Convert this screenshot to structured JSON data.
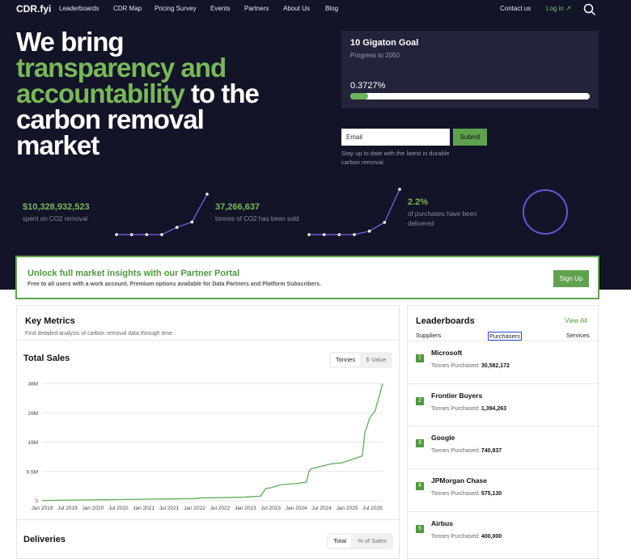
{
  "nav": {
    "logo": "CDR.fyi",
    "links": [
      "Leaderboards",
      "CDR Map",
      "Pricing Survey",
      "Events",
      "Partners",
      "About Us",
      "Blog"
    ],
    "contact": "Contact us",
    "login": "Log in ↗"
  },
  "hero": {
    "line1": "We bring",
    "line2": "transparency and",
    "line3_green": "accountability",
    "line3_rest": " to the",
    "line4": "carbon removal",
    "line5": "market"
  },
  "goal": {
    "title": "10 Gigaton Goal",
    "subtitle": "Progress to 2050",
    "percent_text": "0.3727%",
    "progress_fraction": 0.075
  },
  "newsletter": {
    "placeholder": "Email",
    "submit": "Submit",
    "note": "Stay up to date with the latest in durable carbon removal."
  },
  "stats": [
    {
      "value": "$10,328,932,523",
      "label": "spent on CO2 removal"
    },
    {
      "value": "37,266,637",
      "label": "tonnes of CO2 has been sold"
    },
    {
      "value": "2.2%",
      "label": "of purchases have been delivered"
    }
  ],
  "partner": {
    "title": "Unlock full market insights with our Partner Portal",
    "subtitle": "Free to all users with a work account.  Premium options available for Data Partners and Platform Subscribers.",
    "button": "Sign Up"
  },
  "metrics": {
    "title": "Key Metrics",
    "subtitle": "Find detailed analysis of carbon removal data through time.",
    "sales_title": "Total Sales",
    "sales_toggle": [
      "Tonnes",
      "$ Value"
    ],
    "deliveries_title": "Deliveries",
    "deliveries_toggle": [
      "Total",
      "% of Sales"
    ]
  },
  "chart_data": {
    "type": "line",
    "title": "Total Sales",
    "ylabel": "",
    "xlabel": "",
    "ylim": [
      0,
      38
    ],
    "yticks": [
      "0",
      "9.5M",
      "19M",
      "29M",
      "38M"
    ],
    "xticks": [
      "Jan 2019",
      "Jul 2019",
      "Jan 2020",
      "Jul 2020",
      "Jan 2021",
      "Jul 2021",
      "Jan 2022",
      "Jul 2022",
      "Jan 2023",
      "Jul 2023",
      "Jan 2024",
      "Jul 2024",
      "Jan 2025",
      "Jul 2025"
    ],
    "grid": true,
    "color": "#5fae5a",
    "series": [
      {
        "x": [
          2019.0,
          2019.5,
          2020.0,
          2020.5,
          2021.0,
          2021.5,
          2022.0,
          2022.1,
          2022.5,
          2023.0,
          2023.3,
          2023.4,
          2023.5,
          2023.7,
          2024.0,
          2024.2,
          2024.25,
          2024.3,
          2024.5,
          2024.7,
          2024.9,
          2025.1,
          2025.3,
          2025.35,
          2025.45,
          2025.55,
          2025.65,
          2025.7
        ],
        "values": [
          0.1,
          0.2,
          0.3,
          0.4,
          0.5,
          0.6,
          0.7,
          0.9,
          1.0,
          1.2,
          1.5,
          4.0,
          4.2,
          5.2,
          5.6,
          6.0,
          9.5,
          10.4,
          11.2,
          12.0,
          12.3,
          13.4,
          14.5,
          22.0,
          27.0,
          29.0,
          35.0,
          38.0
        ]
      }
    ]
  },
  "leaderboards": {
    "title": "Leaderboards",
    "view_all": "View All",
    "tabs": [
      "Suppliers",
      "Purchasers",
      "Services"
    ],
    "detail_label": "Tonnes Purchased:",
    "rows": [
      {
        "rank": "1",
        "name": "Microsoft",
        "value": "30,582,172"
      },
      {
        "rank": "2",
        "name": "Frontier Buyers",
        "value": "1,394,263"
      },
      {
        "rank": "3",
        "name": "Google",
        "value": "740,837"
      },
      {
        "rank": "4",
        "name": "JPMorgan Chase",
        "value": "575,130"
      },
      {
        "rank": "5",
        "name": "Airbus",
        "value": "400,000"
      }
    ]
  },
  "sparklines": [
    {
      "values": [
        0,
        0,
        0,
        0,
        8,
        14,
        45
      ]
    },
    {
      "values": [
        0,
        0,
        0,
        0,
        4,
        14,
        52
      ]
    }
  ]
}
